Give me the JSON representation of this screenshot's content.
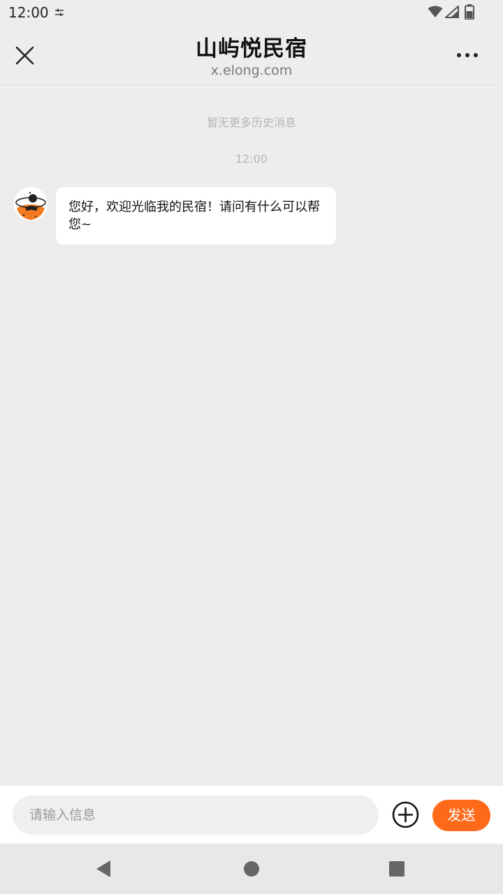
{
  "status_bar": {
    "time": "12:00",
    "icons": [
      "settings-icon",
      "wifi-icon",
      "signal-icon",
      "battery-icon"
    ]
  },
  "header": {
    "title": "山屿悦民宿",
    "subtitle": "x.elong.com",
    "close_icon": "close-icon",
    "more_icon": "more-icon"
  },
  "chat": {
    "no_history_text": "暂无更多历史消息",
    "timestamp": "12:00",
    "messages": [
      {
        "sender": "host",
        "avatar_icon": "host-avatar",
        "text": "您好，欢迎光临我的民宿！请问有什么可以帮您~"
      }
    ]
  },
  "input_bar": {
    "placeholder": "请输入信息",
    "value": "",
    "plus_icon": "add-circle-icon",
    "send_label": "发送"
  },
  "nav_bar": {
    "icons": [
      "back-icon",
      "home-icon",
      "recents-icon"
    ]
  },
  "colors": {
    "accent": "#ff6a1a",
    "background": "#ededed",
    "bubble": "#ffffff",
    "muted_text": "#b5b5b5"
  }
}
